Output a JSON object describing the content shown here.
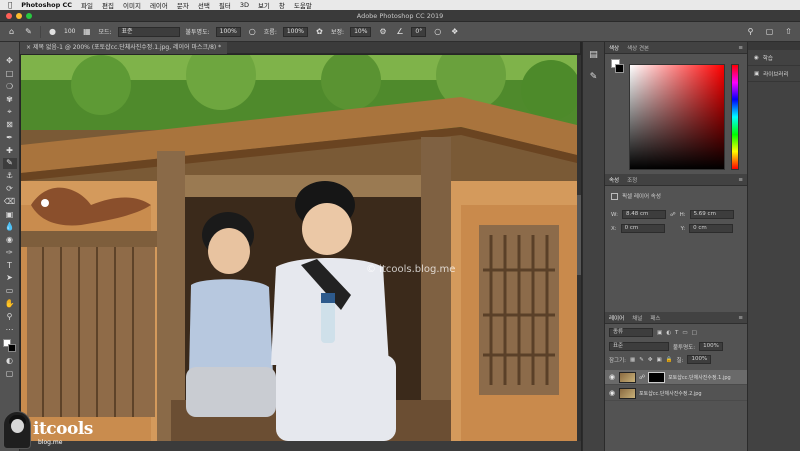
{
  "menubar": {
    "app": "Photoshop CC",
    "items": [
      "파일",
      "편집",
      "이미지",
      "레이어",
      "문자",
      "선택",
      "필터",
      "3D",
      "보기",
      "창",
      "도움말"
    ]
  },
  "window": {
    "title": "Adobe Photoshop CC 2019"
  },
  "options": {
    "brush_size": "100",
    "mode_label": "모드:",
    "mode_value": "표준",
    "opacity_label": "불투명도:",
    "opacity_value": "100%",
    "flow_label": "흐름:",
    "flow_value": "100%",
    "smooth_label": "보정:",
    "smooth_value": "10%",
    "angle_value": "0°"
  },
  "document": {
    "tab_title": "제목 없음-1 @ 200% (포토샵cc.단체사진수정.1.jpg, 레이어 마스크/8) *"
  },
  "canvas": {
    "watermark": "© itcools.blog.me"
  },
  "color_panel": {
    "tabs": [
      "색상",
      "색상 견본"
    ]
  },
  "properties_panel": {
    "tabs": [
      "속성",
      "조정"
    ],
    "type": "픽셀 레이어 속성",
    "w_label": "W:",
    "w_value": "8.48 cm",
    "h_label": "H:",
    "h_value": "5.69 cm",
    "x_label": "X:",
    "x_value": "0 cm",
    "y_label": "Y:",
    "y_value": "0 cm"
  },
  "layers_panel": {
    "tabs": [
      "레이어",
      "채널",
      "패스"
    ],
    "filter": "종류",
    "blend": "표준",
    "opacity_label": "불투명도:",
    "opacity_value": "100%",
    "lock_label": "잠그기:",
    "fill_label": "칠:",
    "fill_value": "100%",
    "layers": [
      {
        "name": "포토샵cc.단체사진수정.1.jpg",
        "has_mask": true
      },
      {
        "name": "포토샵cc.단체사진수정.2.jpg",
        "has_mask": false
      }
    ]
  },
  "right_panel": {
    "items": [
      "학습",
      "라이브러리"
    ]
  },
  "logo": {
    "text": "itcools",
    "sub": "blog.me"
  },
  "colors": {
    "accent_red": "#ff0000",
    "panel_bg": "#535353",
    "menubar_bg": "#e9e9e9"
  }
}
